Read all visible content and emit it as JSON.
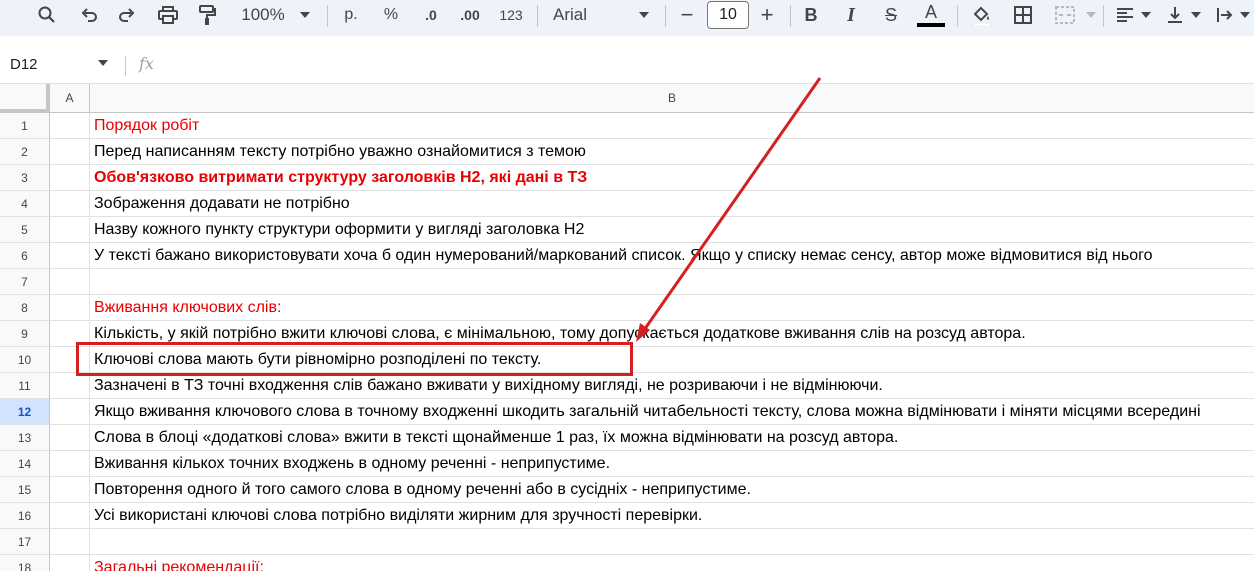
{
  "toolbar": {
    "zoom": "100%",
    "currency_label": "р.",
    "percent_label": "%",
    "decrease_decimals_label": ".0",
    "increase_decimals_label": ".00",
    "number_format_label": "123",
    "font_name": "Arial",
    "font_size": "10",
    "decrease_font_label": "−",
    "increase_font_label": "+",
    "bold_label": "B",
    "italic_label": "I",
    "strikethrough_label": "S",
    "text_color_label": "A"
  },
  "formula_bar": {
    "cell_ref": "D12",
    "fx_label": "fx"
  },
  "columns": [
    "A",
    "B"
  ],
  "active_row": 12,
  "rows": [
    {
      "num": "1",
      "text": "Порядок робіт",
      "style": "red"
    },
    {
      "num": "2",
      "text": "Перед написанням тексту потрібно уважно ознайомитися з темою",
      "style": ""
    },
    {
      "num": "3",
      "text": "Обов'язково витримати структуру заголовків Н2, які дані в ТЗ",
      "style": "red bold"
    },
    {
      "num": "4",
      "text": "Зображення додавати не потрібно",
      "style": ""
    },
    {
      "num": "5",
      "text": "Назву кожного пункту структури оформити у вигляді заголовка Н2",
      "style": ""
    },
    {
      "num": "6",
      "text": "У тексті бажано використовувати хоча б один нумерований/маркований список. Якщо у списку немає сенсу, автор може відмовитися від нього",
      "style": ""
    },
    {
      "num": "7",
      "text": "",
      "style": ""
    },
    {
      "num": "8",
      "text": "Вживання ключових слів:",
      "style": "red"
    },
    {
      "num": "9",
      "text": "Кількість, у якій потрібно вжити ключові слова, є мінімальною, тому допускається додаткове вживання слів на розсуд автора.",
      "style": ""
    },
    {
      "num": "10",
      "text": "Ключові слова мають бути рівномірно розподілені по тексту.",
      "style": ""
    },
    {
      "num": "11",
      "text": "Зазначені в ТЗ точні входження слів бажано вживати у вихідному вигляді, не розриваючи і не відмінюючи.",
      "style": ""
    },
    {
      "num": "12",
      "text": "Якщо вживання ключового слова в точному входженні шкодить загальній читабельності тексту, слова можна відмінювати і міняти місцями всередині",
      "style": ""
    },
    {
      "num": "13",
      "text": "Слова в блоці «додаткові слова» вжити в тексті щонайменше 1 раз, їх можна відмінювати на розсуд автора.",
      "style": ""
    },
    {
      "num": "14",
      "text": "Вживання кількох точних входжень в одному реченні - неприпустиме.",
      "style": ""
    },
    {
      "num": "15",
      "text": "Повторення одного й того самого слова в одному реченні або в сусідніх - неприпустиме.",
      "style": ""
    },
    {
      "num": "16",
      "text": "Усі використані ключові слова потрібно виділяти жирним для зручності перевірки.",
      "style": ""
    },
    {
      "num": "17",
      "text": "",
      "style": ""
    },
    {
      "num": "18",
      "text": "Загальні рекомендації:",
      "style": "red"
    }
  ],
  "colors": {
    "toolbar_bg": "#eef2f9",
    "header_bg": "#f8f9fa",
    "active_row_bg": "#d3e3fd",
    "red_text": "#ea0000",
    "annotation": "#d42020"
  }
}
